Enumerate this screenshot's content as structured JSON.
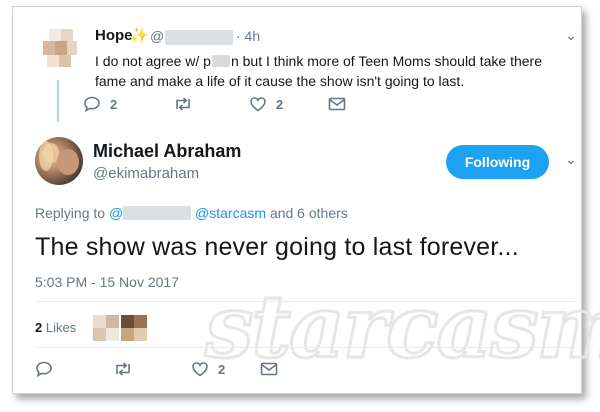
{
  "reply_tweet": {
    "name": "Hope",
    "sparkle_icon": "sparkle-emoji",
    "handle_prefix": "@",
    "time": "· 4h",
    "text_before": "I do not agree w/ p",
    "text_after": "n but I think more of Teen Moms should take there fame and make a life of it cause the show isn't going to last.",
    "actions": {
      "replies": "2",
      "likes": "2"
    }
  },
  "main_tweet": {
    "name": "Michael Abraham",
    "handle": "@ekimabraham",
    "follow_label": "Following",
    "replying_prefix": "Replying to",
    "replying_at": "@",
    "replying_mention": "@starcasm",
    "replying_suffix": "and 6 others",
    "text": "The show was never going to last forever...",
    "timestamp": "5:03 PM - 15 Nov 2017",
    "likes_count": "2",
    "likes_label": "Likes",
    "actions": {
      "likes": "2"
    }
  },
  "watermark": "starcasm",
  "colors": {
    "accent": "#1da1f2",
    "link": "#1b95e0",
    "muted": "#657786"
  }
}
